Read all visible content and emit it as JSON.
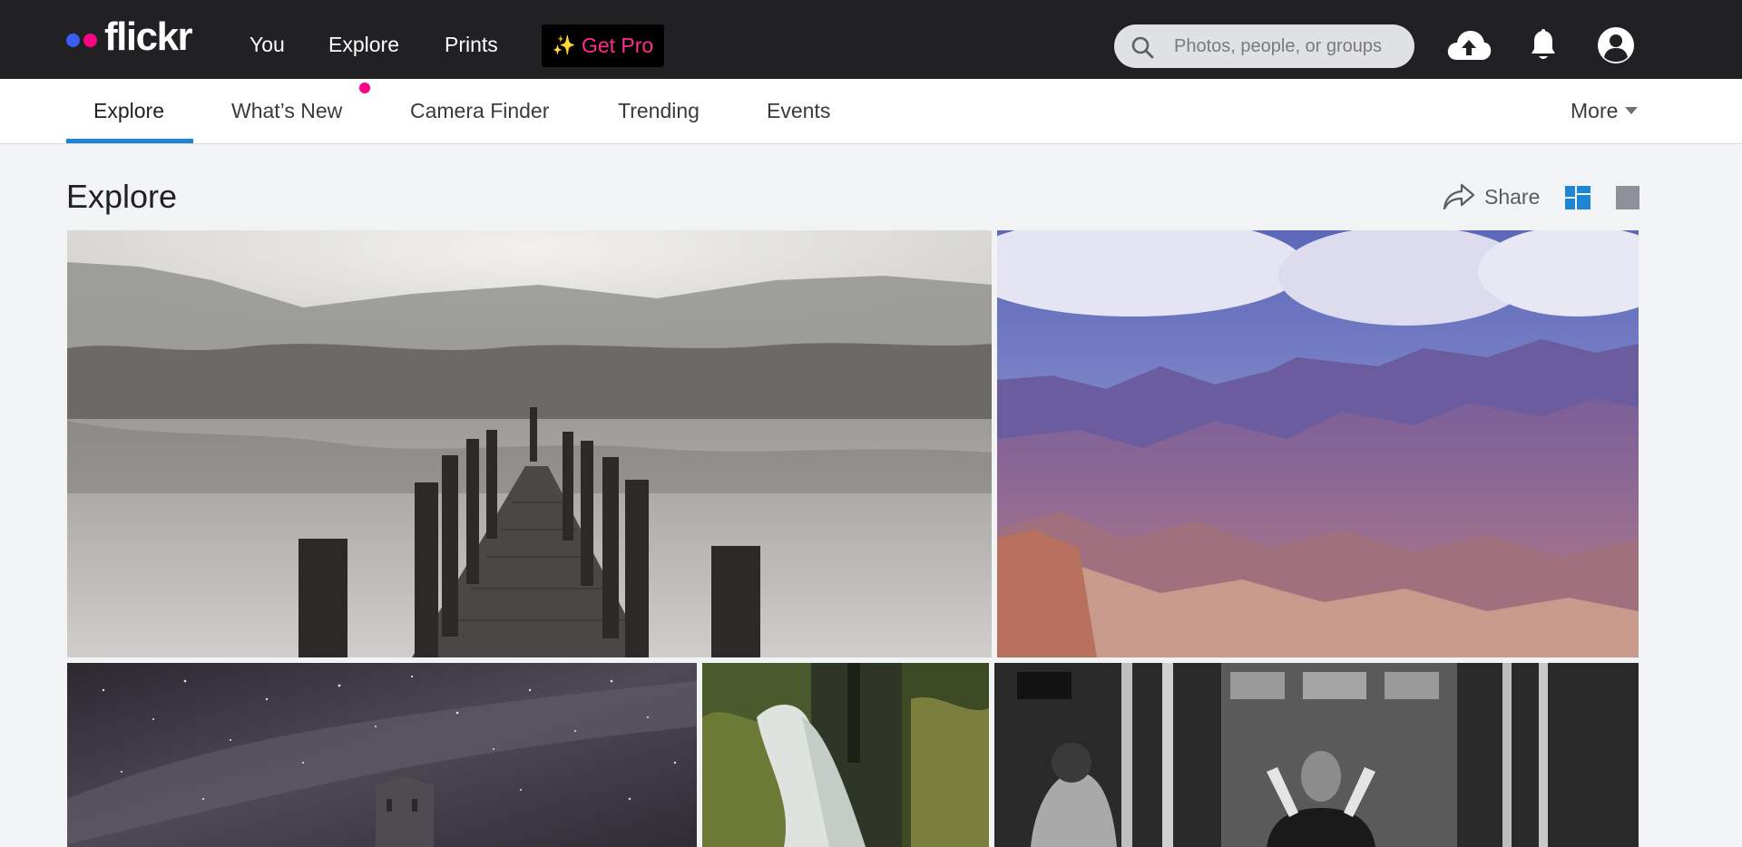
{
  "app": {
    "logo_text": "flickr"
  },
  "topnav": {
    "links": [
      {
        "label": "You"
      },
      {
        "label": "Explore"
      },
      {
        "label": "Prints"
      }
    ],
    "get_pro": {
      "sparkle": "✨",
      "label": "Get Pro"
    },
    "search": {
      "placeholder": "Photos, people, or groups"
    },
    "icons": [
      "upload-cloud-icon",
      "bell-icon",
      "user-avatar-icon"
    ]
  },
  "subnav": {
    "tabs": [
      {
        "label": "Explore",
        "active": true
      },
      {
        "label": "What’s New",
        "new_indicator": true
      },
      {
        "label": "Camera Finder"
      },
      {
        "label": "Trending"
      },
      {
        "label": "Events"
      }
    ],
    "more_label": "More"
  },
  "page": {
    "title": "Explore",
    "share_label": "Share",
    "layout_icons": [
      "justified-grid-icon",
      "single-photo-icon"
    ]
  },
  "photos": [
    {
      "subject": "misty lake with wooden jetty"
    },
    {
      "subject": "grand canyon under stormy sky"
    },
    {
      "subject": "stone tower under milky way"
    },
    {
      "subject": "forest waterfall"
    },
    {
      "subject": "black and white street portrait"
    }
  ],
  "colors": {
    "topnav_bg": "#212124",
    "brand_blue": "#3b5df0",
    "brand_pink": "#ff0084",
    "active_tab": "#1d86d4",
    "page_bg": "#f2f3f5"
  }
}
